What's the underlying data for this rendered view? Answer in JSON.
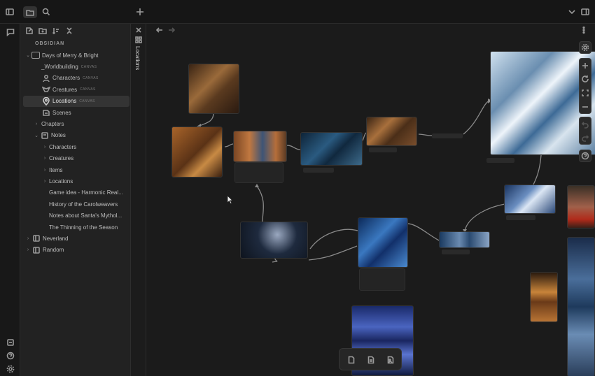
{
  "app": {
    "vault_label": "OBSIDIAN",
    "vertical_tab_label": "Locations"
  },
  "tree": [
    {
      "label": "Days of Merry & Bright",
      "type": "folder",
      "expanded": true,
      "depth": 0,
      "tag": ""
    },
    {
      "label": "_Worldbuilding",
      "type": "canvas",
      "depth": 1,
      "tag": "CANVAS"
    },
    {
      "label": "Characters",
      "type": "canvas",
      "depth": 1,
      "tag": "CANVAS",
      "icon": "user-icon"
    },
    {
      "label": "Creatures",
      "type": "canvas",
      "depth": 1,
      "tag": "CANVAS",
      "icon": "bird-icon"
    },
    {
      "label": "Locations",
      "type": "canvas",
      "depth": 1,
      "tag": "CANVAS",
      "icon": "map-pin-icon",
      "selected": true
    },
    {
      "label": "Scenes",
      "type": "file",
      "depth": 1,
      "tag": "",
      "icon": "scene-icon"
    },
    {
      "label": "Chapters",
      "type": "folder",
      "depth": 1,
      "tag": ""
    },
    {
      "label": "Notes",
      "type": "folder",
      "expanded": true,
      "depth": 1,
      "tag": ""
    },
    {
      "label": "Characters",
      "type": "folder",
      "depth": 2,
      "tag": ""
    },
    {
      "label": "Creatures",
      "type": "folder",
      "depth": 2,
      "tag": ""
    },
    {
      "label": "Items",
      "type": "folder",
      "depth": 2,
      "tag": ""
    },
    {
      "label": "Locations",
      "type": "folder",
      "depth": 2,
      "tag": ""
    },
    {
      "label": "Game idea - Harmonic Real...",
      "type": "note",
      "depth": 2,
      "tag": ""
    },
    {
      "label": "History of the Carolweavers",
      "type": "note",
      "depth": 2,
      "tag": ""
    },
    {
      "label": "Notes about Santa's Mythol...",
      "type": "note",
      "depth": 2,
      "tag": ""
    },
    {
      "label": "The Thinning of the Season",
      "type": "note",
      "depth": 2,
      "tag": ""
    },
    {
      "label": "Neverland",
      "type": "folder",
      "depth": 0,
      "tag": ""
    },
    {
      "label": "Random",
      "type": "folder",
      "depth": 0,
      "tag": ""
    }
  ],
  "colors": {
    "warm_node": "#7a4a24",
    "cool_node": "#2c4f7a",
    "sky_node": "#a9c3da",
    "edge": "#8a8a8a"
  }
}
